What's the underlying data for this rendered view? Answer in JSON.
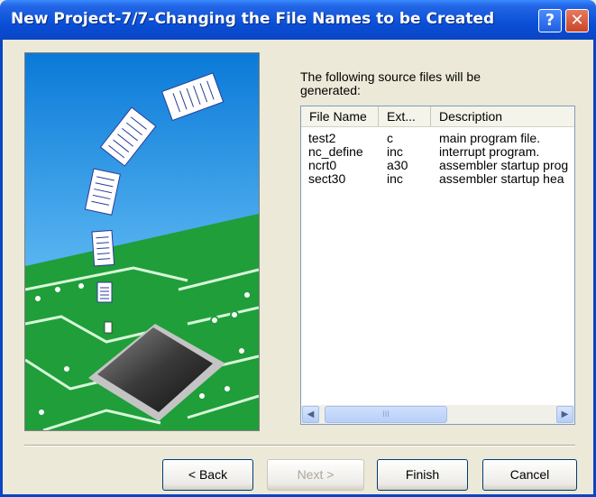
{
  "window": {
    "title": "New Project-7/7-Changing the File Names to be Created",
    "help": "?",
    "close": "✕"
  },
  "intro": "The following source files will be generated:",
  "list": {
    "columns": [
      "File Name",
      "Ext...",
      "Description"
    ],
    "rows": [
      {
        "name": "test2",
        "ext": "c",
        "desc": "main program file."
      },
      {
        "name": "nc_define",
        "ext": "inc",
        "desc": "interrupt program."
      },
      {
        "name": "ncrt0",
        "ext": "a30",
        "desc": "assembler startup prog"
      },
      {
        "name": "sect30",
        "ext": "inc",
        "desc": "assembler startup hea"
      }
    ],
    "scroll_left": "◀",
    "scroll_right": "▶",
    "thumb_grip": "III"
  },
  "buttons": {
    "back": "< Back",
    "next": "Next >",
    "finish": "Finish",
    "cancel": "Cancel"
  }
}
